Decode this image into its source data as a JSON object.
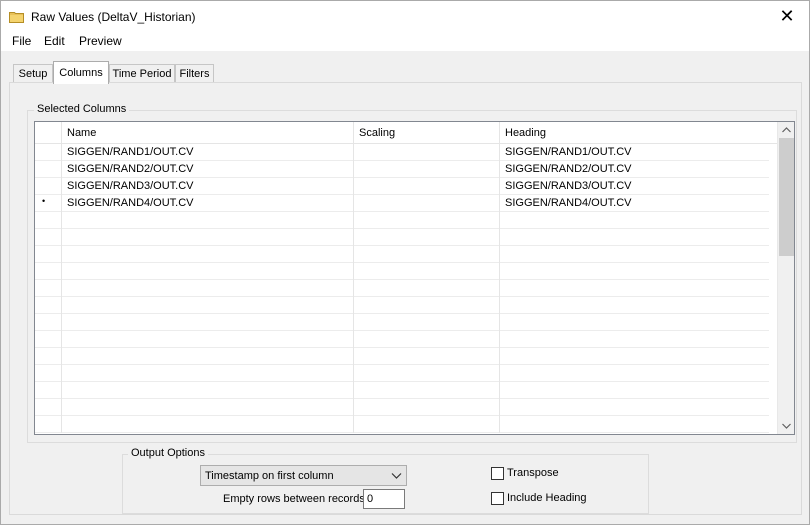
{
  "window": {
    "title": "Raw Values (DeltaV_Historian)",
    "close_glyph": "✕"
  },
  "menu": [
    "File",
    "Edit",
    "Preview"
  ],
  "tabs": [
    {
      "label": "Setup",
      "active": false
    },
    {
      "label": "Columns",
      "active": true
    },
    {
      "label": "Time Period",
      "active": false
    },
    {
      "label": "Filters",
      "active": false
    }
  ],
  "selected_columns": {
    "group_label": "Selected Columns",
    "headers": {
      "name": "Name",
      "scaling": "Scaling",
      "heading": "Heading"
    },
    "rows": [
      {
        "name": "SIGGEN/RAND1/OUT.CV",
        "scaling": "",
        "heading": "SIGGEN/RAND1/OUT.CV",
        "marker": ""
      },
      {
        "name": "SIGGEN/RAND2/OUT.CV",
        "scaling": "",
        "heading": "SIGGEN/RAND2/OUT.CV",
        "marker": ""
      },
      {
        "name": "SIGGEN/RAND3/OUT.CV",
        "scaling": "",
        "heading": "SIGGEN/RAND3/OUT.CV",
        "marker": ""
      },
      {
        "name": "SIGGEN/RAND4/OUT.CV",
        "scaling": "",
        "heading": "SIGGEN/RAND4/OUT.CV",
        "marker": "•"
      }
    ],
    "empty_rows": 13
  },
  "output_options": {
    "group_label": "Output Options",
    "timestamp_select": "Timestamp on first column",
    "empty_rows_label": "Empty rows between records",
    "empty_rows_value": "0",
    "transpose_label": "Transpose",
    "transpose_checked": false,
    "include_heading_label": "Include Heading",
    "include_heading_checked": false
  },
  "colors": {
    "folder_icon": "#e8c15a",
    "window_bg": "#f0f0f0",
    "grid_border": "#828790"
  },
  "icons": {
    "title": "folder-icon",
    "scroll_up": "chevron-up-icon",
    "scroll_down": "chevron-down-icon",
    "combo": "chevron-down-icon"
  }
}
